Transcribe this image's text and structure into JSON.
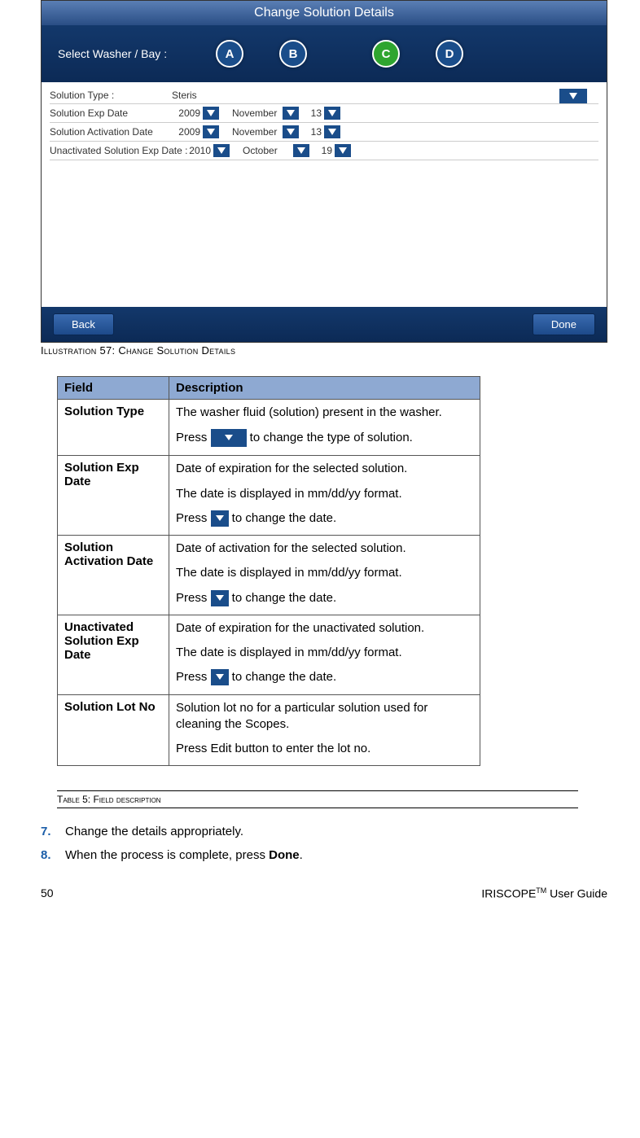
{
  "app": {
    "title": "Change Solution Details",
    "select_label": "Select Washer / Bay :",
    "bays": {
      "a": "A",
      "b": "B",
      "c": "C",
      "d": "D"
    },
    "rows": {
      "type": {
        "label": "Solution Type :",
        "value": "Steris"
      },
      "exp": {
        "label": "Solution Exp Date",
        "year": "2009",
        "month": "November",
        "day": "13"
      },
      "act": {
        "label": "Solution Activation Date",
        "year": "2009",
        "month": "November",
        "day": "13"
      },
      "unact": {
        "label": "Unactivated Solution Exp Date :",
        "year": "2010",
        "month": "October",
        "day": "19"
      }
    },
    "back": "Back",
    "done": "Done"
  },
  "illustration_caption": "Illustration 57: Change Solution Details",
  "table": {
    "head_field": "Field",
    "head_desc": "Description",
    "rows": [
      {
        "field": "Solution Type",
        "p1": "The washer fluid (solution) present in the washer.",
        "p2a": "Press ",
        "p2b": " to change the type of solution.",
        "icon": "big"
      },
      {
        "field": "Solution Exp Date",
        "p1": "Date of expiration for the selected solution.",
        "p2": "The date is displayed in mm/dd/yy format.",
        "p3a": "Press ",
        "p3b": " to change the date.",
        "icon": "small"
      },
      {
        "field": "Solution Activation Date",
        "p1": "Date of activation for the selected solution.",
        "p2": "The date is displayed in mm/dd/yy format.",
        "p3a": "Press ",
        "p3b": " to change the date.",
        "icon": "small"
      },
      {
        "field": "Unactivated Solution Exp Date",
        "p1": "Date of expiration for the unactivated solution.",
        "p2": "The date is displayed in mm/dd/yy format.",
        "p3a": "Press ",
        "p3b": " to change the date.",
        "icon": "small"
      },
      {
        "field": "Solution Lot No",
        "p1": "Solution lot no for a particular solution used for cleaning the Scopes.",
        "p2": "Press Edit button to enter the lot no."
      }
    ]
  },
  "table_caption": "Table 5: Field description",
  "steps": {
    "s7num": "7.",
    "s7": "Change the details appropriately.",
    "s8num": "8.",
    "s8a": "When the process is complete, press ",
    "s8b": "Done",
    "s8c": "."
  },
  "footer": {
    "page": "50",
    "guide_a": "IRISCOPE",
    "guide_tm": "TM",
    "guide_b": " User Guide"
  }
}
